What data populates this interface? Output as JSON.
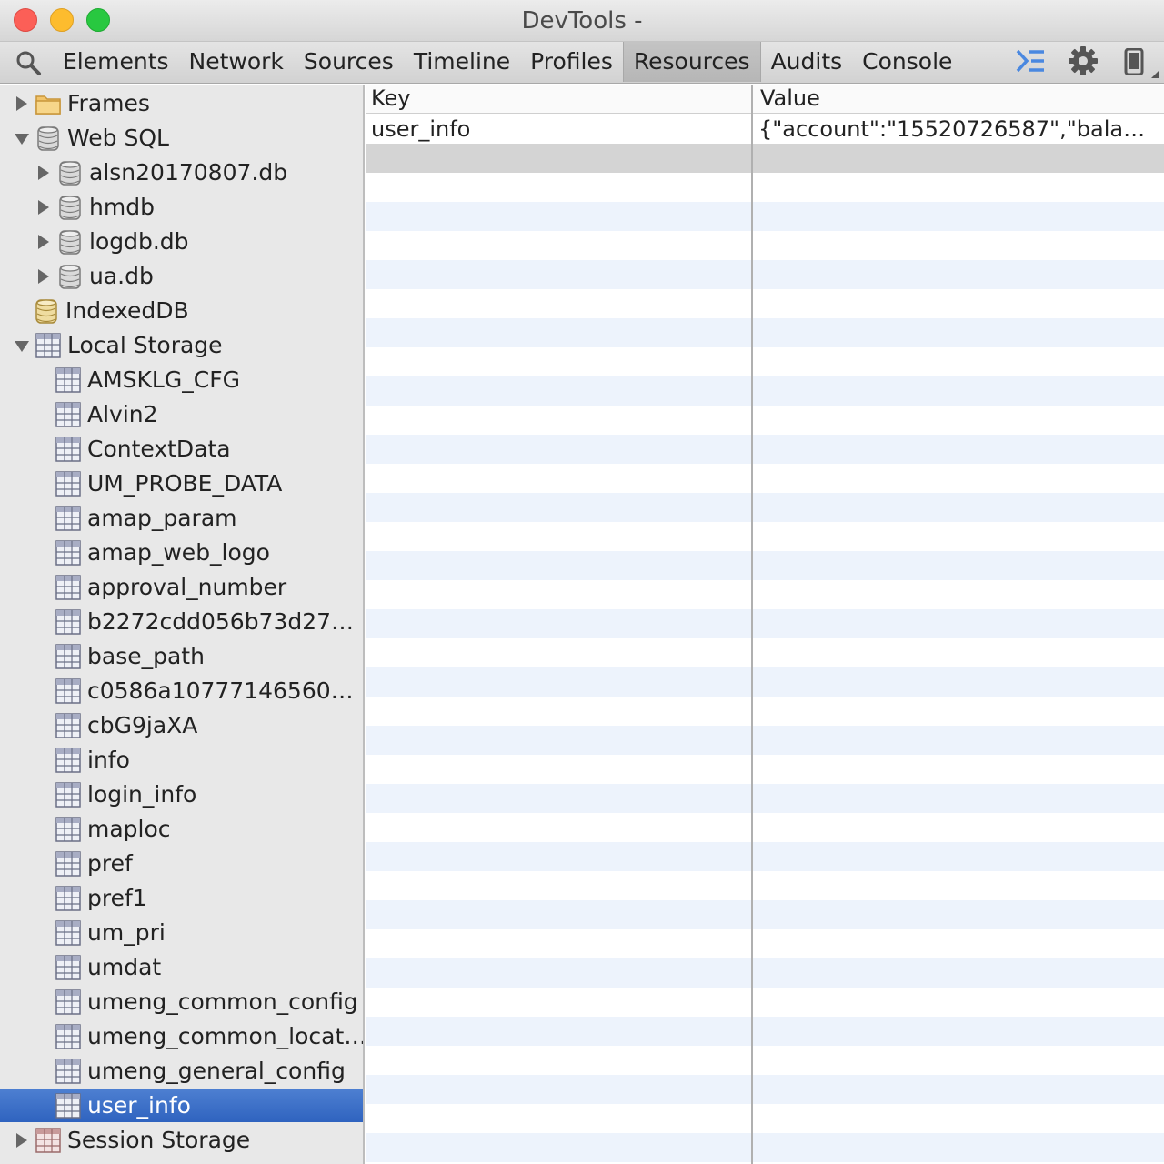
{
  "window": {
    "title": "DevTools -"
  },
  "toolbar": {
    "tabs": [
      "Elements",
      "Network",
      "Sources",
      "Timeline",
      "Profiles",
      "Resources",
      "Audits",
      "Console"
    ],
    "active_tab": "Resources"
  },
  "sidebar": {
    "frames": "Frames",
    "websql": "Web SQL",
    "websql_dbs": [
      "alsn20170807.db",
      "hmdb",
      "logdb.db",
      "ua.db"
    ],
    "indexeddb": "IndexedDB",
    "local_storage": "Local Storage",
    "local_storage_items": [
      "AMSKLG_CFG",
      "Alvin2",
      "ContextData",
      "UM_PROBE_DATA",
      "amap_param",
      "amap_web_logo",
      "approval_number",
      "b2272cdd056b73d27…",
      "base_path",
      "c0586a10777146560…",
      "cbG9jaXA",
      "info",
      "login_info",
      "maploc",
      "pref",
      "pref1",
      "um_pri",
      "umdat",
      "umeng_common_config",
      "umeng_common_locat…",
      "umeng_general_config",
      "user_info"
    ],
    "selected_item": "user_info",
    "session_storage": "Session Storage"
  },
  "grid": {
    "headers": {
      "key": "Key",
      "value": "Value"
    },
    "rows": [
      {
        "key": "user_info",
        "value": "{\"account\":\"15520726587\",\"bala…"
      }
    ]
  },
  "colors": {
    "selection": "#3a6cc8",
    "stripe": "#edf3fc",
    "accent_icon": "#4a88e0"
  }
}
